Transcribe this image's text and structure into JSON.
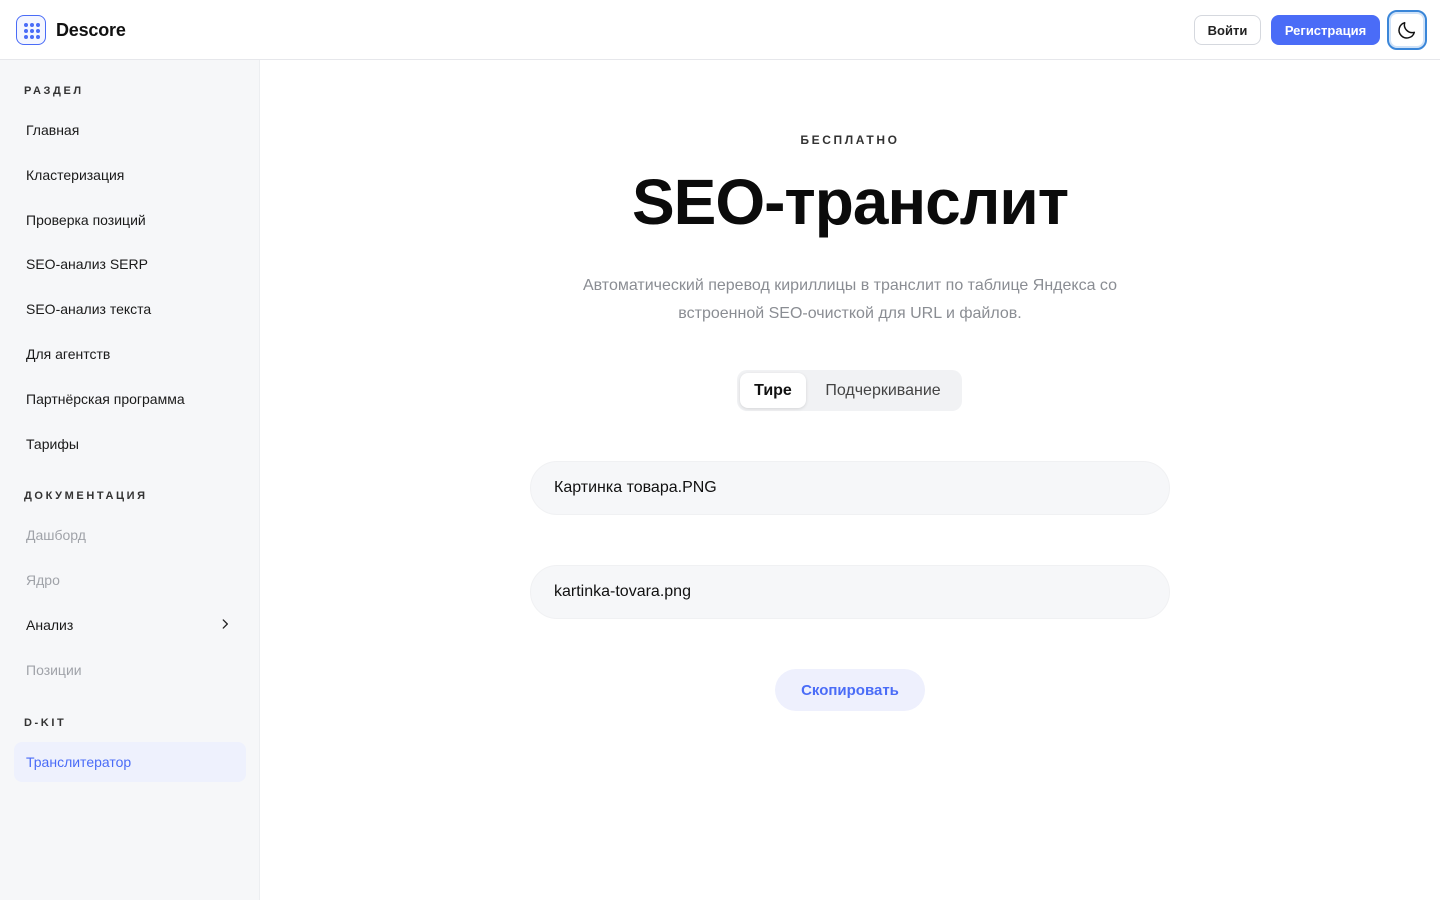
{
  "header": {
    "brand": "Descore",
    "login_label": "Войти",
    "register_label": "Регистрация",
    "theme_icon": "moon-icon",
    "accent": "#4a6cf7"
  },
  "sidebar": {
    "sections": [
      {
        "title": "Раздел",
        "items": [
          {
            "label": "Главная"
          },
          {
            "label": "Кластеризация"
          },
          {
            "label": "Проверка позиций"
          },
          {
            "label": "SEO-анализ SERP"
          },
          {
            "label": "SEO-анализ текста"
          },
          {
            "label": "Для агентств"
          },
          {
            "label": "Партнёрская программа"
          },
          {
            "label": "Тарифы"
          }
        ]
      },
      {
        "title": "Документация",
        "items": [
          {
            "label": "Дашборд"
          },
          {
            "label": "Ядро"
          },
          {
            "label": "Анализ"
          },
          {
            "label": "Позиции"
          }
        ]
      },
      {
        "title": "D-KIT",
        "items": [
          {
            "label": "Транслитератор"
          }
        ]
      }
    ]
  },
  "main": {
    "eyebrow": "БЕСПЛАТНО",
    "title": "SEO-транслит",
    "subtitle_line1": "Автоматический перевод кириллицы в транслит по таблице Яндекса со",
    "subtitle_line2": "встроенной SEO-очисткой для URL и файлов.",
    "separator_tabs": [
      {
        "label": "Тире",
        "selected": true
      },
      {
        "label": "Подчеркивание",
        "selected": false
      }
    ],
    "input_value": "Картинка товара.PNG",
    "output_value": "kartinka-tovara.png",
    "copy_label": "Скопировать"
  }
}
